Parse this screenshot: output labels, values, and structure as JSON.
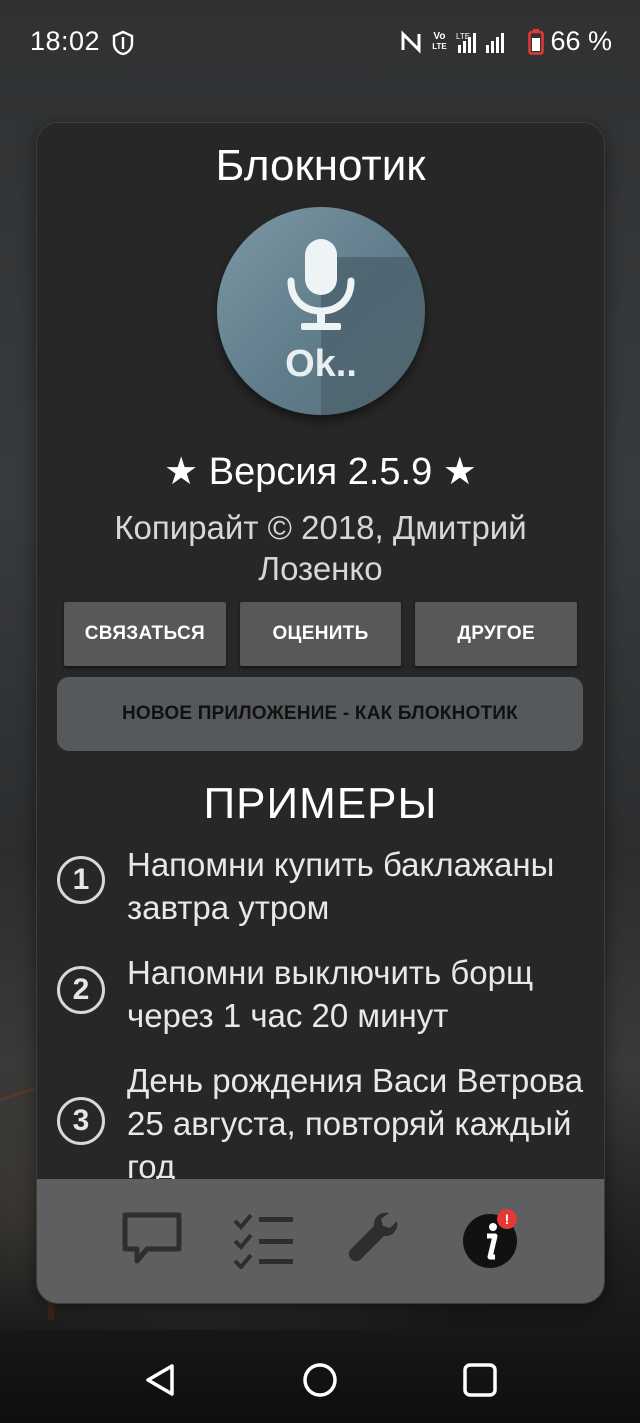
{
  "status_bar": {
    "time": "18:02",
    "volte_top": "Vo",
    "volte_bottom": "LTE",
    "lte_label": "LTE",
    "battery_percent": "66 %"
  },
  "dialog": {
    "title": "Блокнотик",
    "logo_text": "Ok..",
    "version": "★ Версия 2.5.9 ★",
    "copyright": "Копирайт © 2018, Дмитрий Лозенко",
    "buttons": {
      "contact": "СВЯЗАТЬСЯ",
      "rate": "ОЦЕНИТЬ",
      "other": "ДРУГОЕ",
      "new_app": "НОВОЕ ПРИЛОЖЕНИЕ - КАК БЛОКНОТИК"
    },
    "examples_title": "ПРИМЕРЫ",
    "examples": [
      {
        "num": "1",
        "text": "Напомни купить баклажаны завтра утром"
      },
      {
        "num": "2",
        "text": "Напомни выключить борщ через 1 час 20 минут"
      },
      {
        "num": "3",
        "text": "День рождения Васи Ветрова 25 августа, повторяй каждый год"
      }
    ]
  },
  "tabbar": {
    "items": [
      {
        "name": "chat",
        "icon": "chat-bubble-icon"
      },
      {
        "name": "tasks",
        "icon": "checklist-icon"
      },
      {
        "name": "settings",
        "icon": "wrench-icon"
      },
      {
        "name": "info",
        "icon": "info-icon",
        "badge": "!"
      }
    ],
    "colors": {
      "bar": "#5d5f61",
      "icon": "#2e2e2e",
      "badge": "#e53935"
    }
  },
  "navbar": {
    "items": [
      "back-icon",
      "home-icon",
      "recents-icon"
    ]
  },
  "colors": {
    "card_bg": "#272727",
    "logo_bg": "#607d8b",
    "button_bg": "#585858",
    "wide_button_bg": "#56595c"
  }
}
